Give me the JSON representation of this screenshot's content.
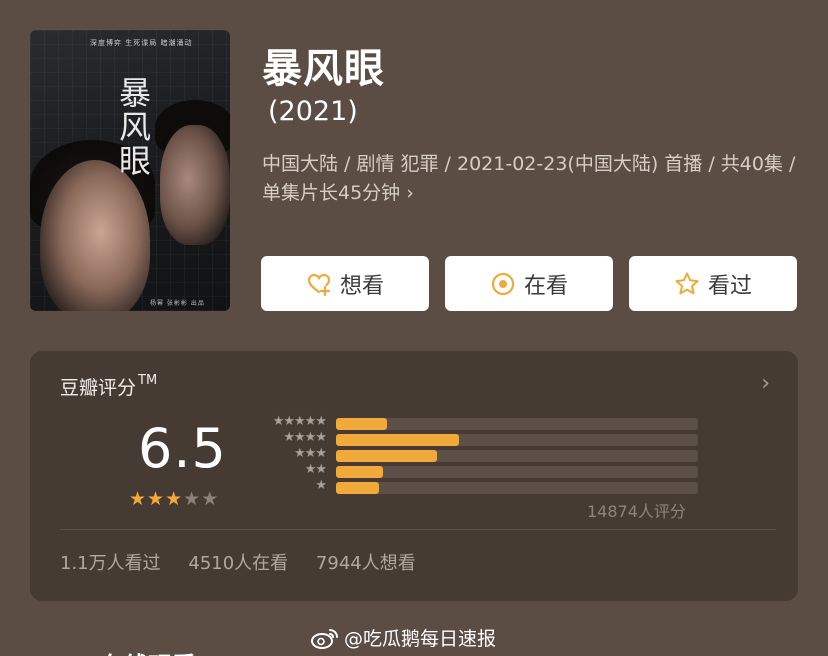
{
  "poster": {
    "calligraphy_title": "暴风眼",
    "tagline": "深度博弈 生死谍局 暗潮涌动",
    "credits": "杨幂 张彬彬 出品"
  },
  "header": {
    "title": "暴风眼",
    "year": "(2021)",
    "meta": "中国大陆 / 剧情 犯罪 / 2021-02-23(中国大陆) 首播 / 共40集 / 单集片长45分钟",
    "meta_chevron": "›"
  },
  "actions": {
    "want_label": "想看",
    "watching_label": "在看",
    "watched_label": "看过"
  },
  "rating": {
    "header": "豆瓣评分",
    "trademark": "TM",
    "chevron": "›",
    "score": "6.5",
    "score_stars_filled": 3,
    "score_stars_total": 5,
    "star_color": "#f2a93b",
    "distribution": [
      {
        "stars": 5,
        "label": "★★★★★",
        "fraction": 0.14
      },
      {
        "stars": 4,
        "label": "★★★★",
        "fraction": 0.34
      },
      {
        "stars": 3,
        "label": "★★★",
        "fraction": 0.28
      },
      {
        "stars": 2,
        "label": "★★",
        "fraction": 0.13
      },
      {
        "stars": 1,
        "label": "★",
        "fraction": 0.12
      }
    ],
    "count_label": "14874人评分",
    "stats": {
      "watched": "1.1万人看过",
      "watching": "4510人在看",
      "want": "7944人想看"
    }
  },
  "watermark": {
    "text": "@吃瓜鹅每日速报",
    "icon": "weibo-icon"
  },
  "next_section": {
    "title": "在线观看"
  }
}
